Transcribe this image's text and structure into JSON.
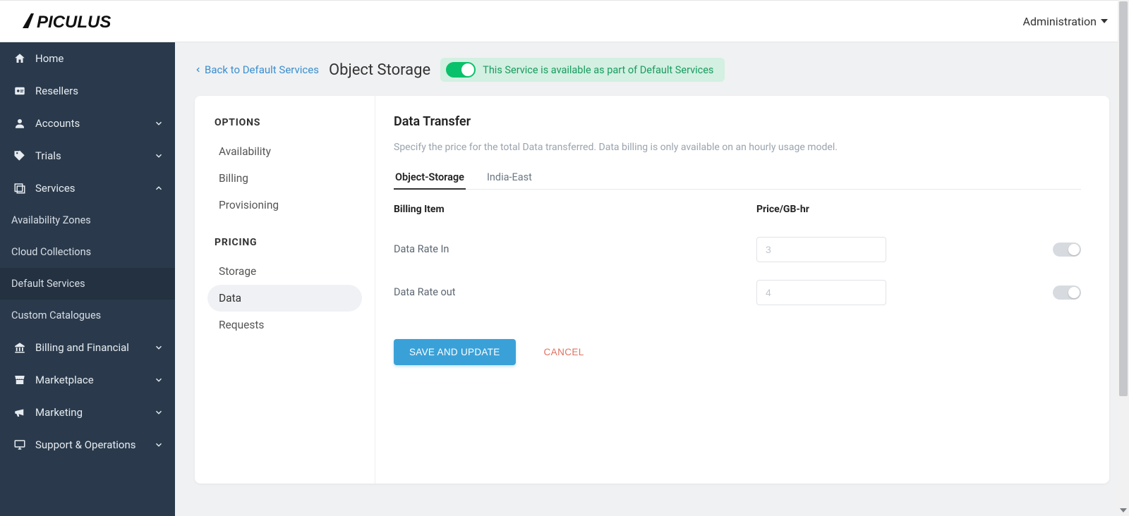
{
  "brand": "APICULUS",
  "topnav": {
    "admin_label": "Administration"
  },
  "sidebar": {
    "items": [
      {
        "label": "Home",
        "icon": "home"
      },
      {
        "label": "Resellers",
        "icon": "badge"
      },
      {
        "label": "Accounts",
        "icon": "user",
        "expandable": true,
        "open": false
      },
      {
        "label": "Trials",
        "icon": "tag",
        "expandable": true,
        "open": false
      },
      {
        "label": "Services",
        "icon": "layers",
        "expandable": true,
        "open": true,
        "children": [
          {
            "label": "Availability Zones"
          },
          {
            "label": "Cloud Collections"
          },
          {
            "label": "Default Services"
          },
          {
            "label": "Custom Catalogues"
          }
        ]
      },
      {
        "label": "Billing and Financial",
        "icon": "bank",
        "expandable": true,
        "open": false
      },
      {
        "label": "Marketplace",
        "icon": "store",
        "expandable": true,
        "open": false
      },
      {
        "label": "Marketing",
        "icon": "megaphone",
        "expandable": true,
        "open": false
      },
      {
        "label": "Support & Operations",
        "icon": "monitor",
        "expandable": true,
        "open": false
      }
    ]
  },
  "header": {
    "back_label": "Back to Default Services",
    "page_title": "Object Storage",
    "status_text": "This Service is available as part of Default Services",
    "status_on": true
  },
  "options": {
    "heading_options": "OPTIONS",
    "heading_pricing": "PRICING",
    "group_options": [
      {
        "label": "Availability"
      },
      {
        "label": "Billing"
      },
      {
        "label": "Provisioning"
      }
    ],
    "group_pricing": [
      {
        "label": "Storage"
      },
      {
        "label": "Data",
        "active": true
      },
      {
        "label": "Requests"
      }
    ]
  },
  "content": {
    "title": "Data Transfer",
    "description": "Specify the price for the total Data transferred. Data billing is only available on an hourly usage model.",
    "tabs": [
      {
        "label": "Object-Storage",
        "active": true
      },
      {
        "label": "India-East",
        "active": false
      }
    ],
    "col_billing_item": "Billing Item",
    "col_price": "Price/GB-hr",
    "rows": [
      {
        "label": "Data Rate In",
        "price": "3",
        "toggle": false
      },
      {
        "label": "Data Rate out",
        "price": "4",
        "toggle": false
      }
    ],
    "save_label": "SAVE AND UPDATE",
    "cancel_label": "CANCEL"
  }
}
